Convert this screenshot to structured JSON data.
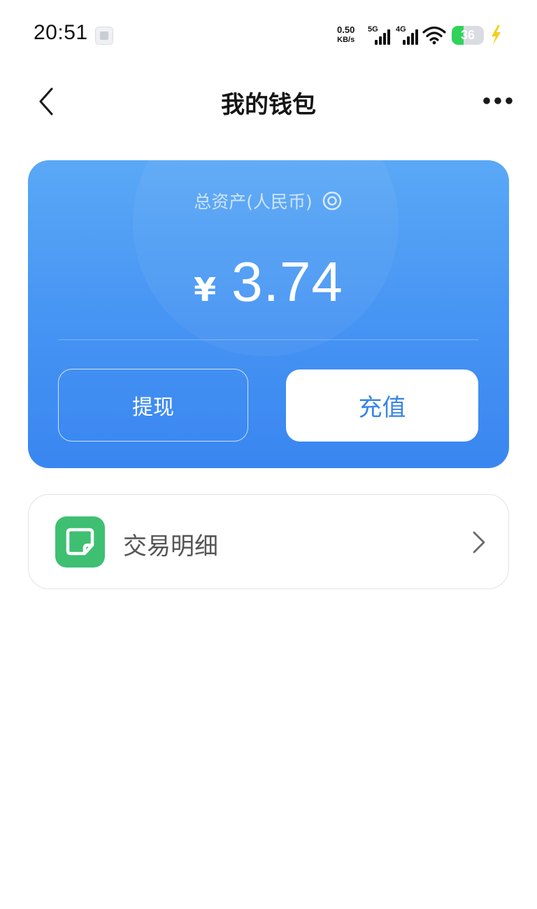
{
  "status_bar": {
    "time": "20:51",
    "network_speed_value": "0.50",
    "network_speed_unit": "KB/s",
    "signal1_type": "5G",
    "signal2_type": "4G",
    "battery_level": "36",
    "battery_fraction": 0.36,
    "battery_color": "#2fd35a",
    "icons": [
      "notification-icon",
      "signal-icon",
      "wifi-icon",
      "battery-icon",
      "charging-icon"
    ]
  },
  "header": {
    "title": "我的钱包",
    "back_icon": "chevron-left-icon",
    "more_icon": "more-horizontal-icon"
  },
  "wallet": {
    "asset_label": "总资产(人民币)",
    "visibility_icon": "eye-icon",
    "currency_symbol": "¥",
    "balance": "3.74",
    "withdraw_label": "提现",
    "recharge_label": "充值",
    "card_color_top": "#5aa8f6",
    "card_color_bottom": "#3a86f1",
    "recharge_text_color": "#3a84e8"
  },
  "transactions": {
    "label": "交易明细",
    "icon": "note-icon",
    "icon_color": "#3fbf72",
    "chevron_icon": "chevron-right-icon"
  }
}
